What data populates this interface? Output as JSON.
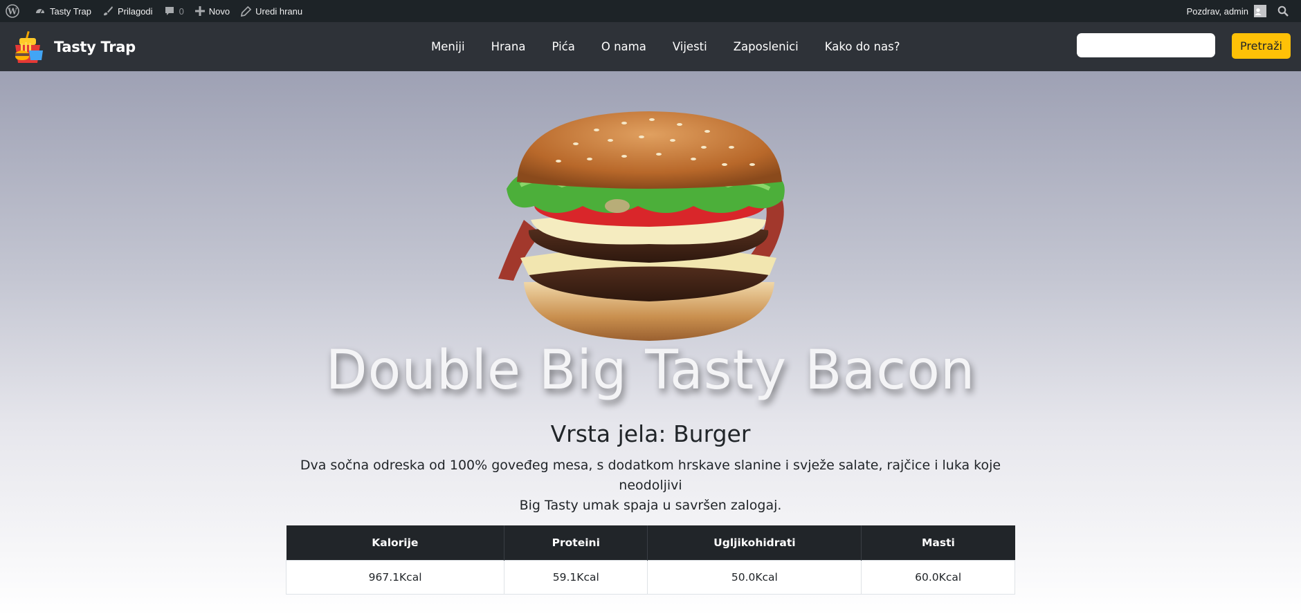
{
  "adminbar": {
    "site_name": "Tasty Trap",
    "customize": "Prilagodi",
    "comments_count": "0",
    "new": "Novo",
    "edit": "Uredi hranu",
    "greeting": "Pozdrav, admin"
  },
  "navbar": {
    "brand": "Tasty Trap",
    "links": [
      "Meniji",
      "Hrana",
      "Pića",
      "O nama",
      "Vijesti",
      "Zaposlenici",
      "Kako do nas?"
    ],
    "search_placeholder": "",
    "search_button": "Pretraži"
  },
  "hero": {
    "title": "Double Big Tasty Bacon",
    "subtitle": "Vrsta jela: Burger",
    "description_line1": "Dva sočna odreska od 100% goveđeg mesa, s dodatkom hrskave slanine i svježe salate, rajčice i luka koje neodoljivi",
    "description_line2": "Big Tasty umak spaja u savršen zalogaj."
  },
  "nutrition": {
    "headers": [
      "Kalorije",
      "Proteini",
      "Ugljikohidrati",
      "Masti"
    ],
    "values": [
      "967.1Kcal",
      "59.1Kcal",
      "50.0Kcal",
      "60.0Kcal"
    ]
  },
  "colors": {
    "adminbar_bg": "#1d2327",
    "navbar_bg": "#2e3238",
    "accent": "#ffc107",
    "table_header_bg": "#212529"
  }
}
